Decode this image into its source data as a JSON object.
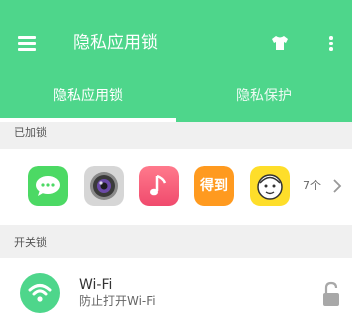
{
  "header": {
    "title": "隐私应用锁",
    "accent_color": "#4ed68b",
    "menu_icon": "menu-icon",
    "theme_icon": "tshirt-icon",
    "more_icon": "more-vertical-icon"
  },
  "tabs": [
    {
      "label": "隐私应用锁",
      "selected": true
    },
    {
      "label": "隐私保护",
      "selected": false
    }
  ],
  "locked_section": {
    "label": "已加锁",
    "apps": [
      {
        "icon": "messages-app-icon",
        "color": "#4cd964"
      },
      {
        "icon": "camera-app-icon",
        "color": "#cfcfcf"
      },
      {
        "icon": "music-app-icon",
        "color": "#f46382"
      },
      {
        "icon": "dedao-app-icon",
        "color": "#ff9a1f",
        "text": "得到"
      },
      {
        "icon": "face-app-icon",
        "color": "#fede2a"
      }
    ],
    "count": "7个"
  },
  "switch_section": {
    "label": "开关锁",
    "items": [
      {
        "title": "Wi-Fi",
        "subtitle": "防止打开Wi-Fi",
        "icon": "wifi-icon",
        "lock_icon": "lock-icon"
      }
    ]
  }
}
